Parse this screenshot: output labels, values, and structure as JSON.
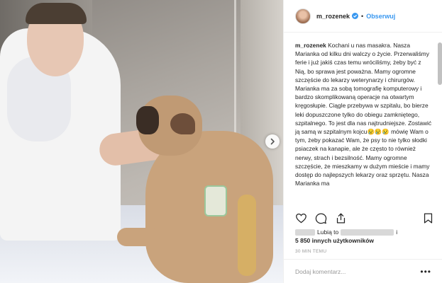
{
  "post": {
    "username": "m_rozenek",
    "follow_label": "Obserwuj",
    "dot": "•",
    "caption_user": "m_rozenek",
    "caption_text": "Kochani u nas masakra. Nasza Marianka od kilku dni walczy o życie. Przerwaliśmy ferie i już jakiś czas temu wróciliśmy, żeby być z Nią, bo sprawa jest poważna. Mamy ogromne szczęście do lekarzy weterynarzy i chirurgów. Marianka ma za sobą tomografię komputerowy i bardzo skomplikowaną operacje na otwartym kręgosłupie. Ciągle przebywa w szpitalu, bo bierze leki dopuszczone tylko do obiegu zamkniętego, szpitalnego. To jest dla nas najtrudniejsze. Zostawić ją samą w szpitalnym kojcu😢😢😢 mówię Wam o tym, żeby pokazać Wam, że psy to nie tylko słodki psiaczek na kanapie, ale że często to również nerwy, strach i bezsilność. Mamy ogromne szczęście, że mieszkamy w dużym mieście i mamy dostęp do najlepszych lekarzy oraz sprzętu. Nasza Marianka ma"
  },
  "likes": {
    "prefix": "Lubią to",
    "joiner": "i",
    "count_text": "5 850 innych użytkowników"
  },
  "timestamp": "30 MIN TEMU",
  "comment_input": {
    "placeholder": "Dodaj komentarz..."
  },
  "more_label": "•••",
  "colors": {
    "link": "#3897f0",
    "text": "#262626",
    "muted": "#999999"
  },
  "icons": [
    "verified-badge-icon",
    "heart-icon",
    "comment-icon",
    "share-icon",
    "bookmark-icon",
    "chevron-right-icon",
    "more-options-icon"
  ]
}
